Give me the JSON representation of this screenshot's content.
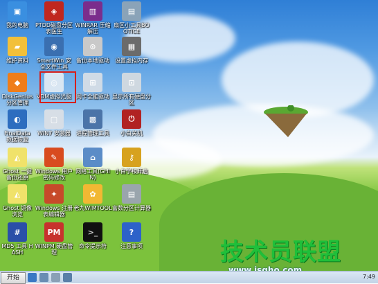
{
  "desktop": {
    "icons": [
      {
        "label": "我的电脑",
        "icon": "computer-icon",
        "color": "#3a8fe0"
      },
      {
        "label": "PTDD磁盘分区表医生",
        "icon": "ptdd-icon",
        "color": "#c0271f"
      },
      {
        "label": "WINRAR 压缩解压",
        "icon": "winrar-icon",
        "color": "#7b2d8c"
      },
      {
        "label": "扇区小工具BOOTICE",
        "icon": "bootice-icon",
        "color": "#8aa3b8"
      },
      {
        "label": "维护资料",
        "icon": "folder-icon",
        "color": "#f2c03a"
      },
      {
        "label": "SmartWin 安全文件工具",
        "icon": "smartwin-icon",
        "color": "#3a6fb0"
      },
      {
        "label": "备份本地驱动",
        "icon": "backup-driver-icon",
        "color": "#c9c9c9"
      },
      {
        "label": "设置虚拟内存",
        "icon": "virtual-memory-icon",
        "color": "#6b6b6b"
      },
      {
        "label": "DiskGenius 分区管理",
        "icon": "diskgenius-icon",
        "color": "#ef7d1a"
      },
      {
        "label": "VDM虚拟光驱",
        "icon": "virtual-drive-icon",
        "color": "#d9e6f2"
      },
      {
        "label": "网卡全能驱动",
        "icon": "network-driver-icon",
        "color": "#d0dbe6"
      },
      {
        "label": "显示所有硬盘分区",
        "icon": "show-partitions-icon",
        "color": "#cfd8e0"
      },
      {
        "label": "FinalData 数据恢复",
        "icon": "finaldata-icon",
        "color": "#2d6dbf"
      },
      {
        "label": "WIN7 安装器",
        "icon": "win7-installer-icon",
        "color": "#d7dee6"
      },
      {
        "label": "进程管理工具",
        "icon": "process-manager-icon",
        "color": "#4b74a8"
      },
      {
        "label": "小白关机",
        "icon": "shutdown-icon",
        "color": "#b12222"
      },
      {
        "label": "Ghost 一键备份还原",
        "icon": "ghost-icon",
        "color": "#f0e26a"
      },
      {
        "label": "Windows 用户密码修改",
        "icon": "password-icon",
        "color": "#d84b1f"
      },
      {
        "label": "网络工具(GHIN)",
        "icon": "network-tool-icon",
        "color": "#5b8cc7"
      },
      {
        "label": "小白学校开启",
        "icon": "key-icon",
        "color": "#d7a21e"
      },
      {
        "label": "Ghost 镜像浏览",
        "icon": "ghost-explorer-icon",
        "color": "#f0e26a"
      },
      {
        "label": "Windows 注册表编辑器",
        "icon": "regedit-icon",
        "color": "#c74a2a"
      },
      {
        "label": "老九WIMTOOL",
        "icon": "wimtool-icon",
        "color": "#f2b833"
      },
      {
        "label": "富数分区计算器",
        "icon": "calculator-icon",
        "color": "#9aa5ad"
      },
      {
        "label": "MD5 工具 HASH",
        "icon": "md5-icon",
        "color": "#2a4fa8"
      },
      {
        "label": "WINPM 硬盘管理",
        "icon": "winpm-icon",
        "color": "#c7322d"
      },
      {
        "label": "命令提示符",
        "icon": "cmd-icon",
        "color": "#111111"
      },
      {
        "label": "注意事项",
        "icon": "help-icon",
        "color": "#2d62c9"
      }
    ]
  },
  "taskbar": {
    "start_label": "开始",
    "clock": "7:49",
    "tray": [
      {
        "icon": "tray-network-icon",
        "color": "#3b78c4"
      },
      {
        "icon": "tray-volume-icon",
        "color": "#6a8db3"
      },
      {
        "icon": "tray-drive-icon",
        "color": "#8aa0b6"
      },
      {
        "icon": "tray-help-icon",
        "color": "#5a7fa8"
      }
    ]
  },
  "watermark": {
    "text": "技术员联盟",
    "url": "www.jsgho.com"
  }
}
